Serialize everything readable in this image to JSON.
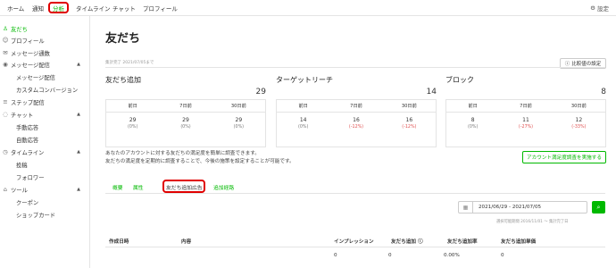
{
  "topnav": {
    "items": [
      "ホーム",
      "通知",
      "分析",
      "タイムライン",
      "チャット",
      "プロフィール"
    ],
    "active_index": 2,
    "settings_label": "設定",
    "settings_icon": "gear-icon"
  },
  "sidebar": {
    "items": [
      {
        "label": "友だち",
        "icon": "person-icon",
        "active": true
      },
      {
        "label": "プロフィール",
        "icon": "profile-icon"
      },
      {
        "label": "メッセージ通数",
        "icon": "mail-icon"
      },
      {
        "label": "メッセージ配信",
        "icon": "broadcast-icon"
      },
      {
        "label": "メッセージ配信",
        "sub": true
      },
      {
        "label": "カスタムコンバージョン",
        "sub": true
      },
      {
        "label": "ステップ配信",
        "icon": "step-icon"
      },
      {
        "label": "チャット",
        "icon": "chat-icon"
      },
      {
        "label": "手動応答",
        "sub": true
      },
      {
        "label": "自動応答",
        "sub": true
      },
      {
        "label": "タイムライン",
        "icon": "timeline-icon"
      },
      {
        "label": "投稿",
        "sub": true
      },
      {
        "label": "フォロワー",
        "sub": true
      },
      {
        "label": "ツール",
        "icon": "tool-icon"
      },
      {
        "label": "クーポン",
        "sub": true
      },
      {
        "label": "ショップカード",
        "sub": true
      }
    ]
  },
  "main": {
    "title": "友だち",
    "aggregation_note": "集計完了 2021/07/05まで",
    "compare_button": "比較値の設定",
    "compare_icon": "info-icon",
    "cards": [
      {
        "title": "友だち追加",
        "total": "29",
        "headers": [
          "前日",
          "7日前",
          "30日前"
        ],
        "values": [
          "29",
          "29",
          "29"
        ],
        "percents": [
          "(0%)",
          "(0%)",
          "(0%)"
        ],
        "neg": [
          false,
          false,
          false
        ]
      },
      {
        "title": "ターゲットリーチ",
        "total": "14",
        "headers": [
          "前日",
          "7日前",
          "30日前"
        ],
        "values": [
          "14",
          "16",
          "16"
        ],
        "percents": [
          "(0%)",
          "(-12%)",
          "(-12%)"
        ],
        "neg": [
          false,
          true,
          true
        ]
      },
      {
        "title": "ブロック",
        "total": "8",
        "headers": [
          "前日",
          "7日前",
          "30日前"
        ],
        "values": [
          "8",
          "11",
          "12"
        ],
        "percents": [
          "(0%)",
          "(-27%)",
          "(-33%)"
        ],
        "neg": [
          false,
          true,
          true
        ]
      }
    ],
    "description_line1": "あなたのアカウントに対する友だちの満足度を簡単に調査できます。",
    "description_line2": "友だちの満足度を定期的に調査することで、今後の施策を設定することが可能です。",
    "survey_button": "アカウント満足度調査を実施する",
    "tabs": [
      "概要",
      "属性",
      "友だち追加広告",
      "追加経路"
    ],
    "active_tab": 2,
    "date_range": "2021/06/29 - 2021/07/05",
    "calendar_icon": "calendar-icon",
    "search_icon": "search-icon",
    "range_note": "選択可能期間 2016/11/01 〜 集計完了日",
    "table": {
      "headers": [
        "作成日時",
        "内容",
        "インプレッション",
        "友だち追加",
        "友だち追加率",
        "友だち追加単価"
      ],
      "row": [
        "0",
        "0",
        "0.00%",
        "0"
      ]
    }
  },
  "colors": {
    "accent": "#00b900",
    "highlight": "#e00000",
    "negative": "#e05050"
  }
}
